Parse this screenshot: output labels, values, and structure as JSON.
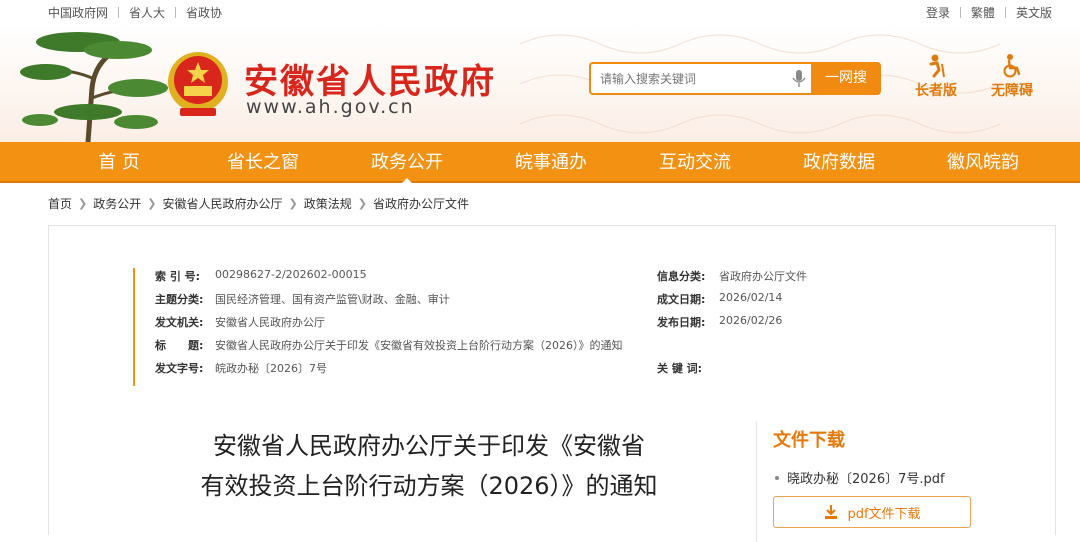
{
  "topbar": {
    "links_left": [
      "中国政府网",
      "省人大",
      "省政协"
    ],
    "links_right": [
      "登录",
      "繁體",
      "英文版"
    ]
  },
  "header": {
    "site_title": "安徽省人民政府",
    "site_url": "www.ah.gov.cn",
    "search_placeholder": "请输入搜索关键词",
    "search_button": "一网搜",
    "quick_links": [
      "长者版",
      "无障碍"
    ]
  },
  "nav": {
    "items": [
      "首 页",
      "省长之窗",
      "政务公开",
      "皖事通办",
      "互动交流",
      "政府数据",
      "徽风皖韵"
    ],
    "active_index": 2
  },
  "breadcrumb": [
    "首页",
    "政务公开",
    "安徽省人民政府办公厅",
    "政策法规",
    "省政府办公厅文件"
  ],
  "meta": {
    "index_label": "索 引 号:",
    "index_value": "00298627-2/202602-00015",
    "category_label": "信息分类:",
    "category_value": "省政府办公厅文件",
    "topic_label": "主题分类:",
    "topic_value": "国民经济管理、国有资产监管\\财政、金融、审计",
    "created_label": "成文日期:",
    "created_value": "2026/02/14",
    "issuer_label": "发文机关:",
    "issuer_value": "安徽省人民政府办公厅",
    "published_label": "发布日期:",
    "published_value": "2026/02/26",
    "title_label": "标　　题:",
    "title_value": "安徽省人民政府办公厅关于印发《安徽省有效投资上台阶行动方案（2026）》的通知",
    "docno_label": "发文字号:",
    "docno_value": "皖政办秘〔2026〕7号",
    "keywords_label": "关 键 词:",
    "keywords_value": ""
  },
  "document": {
    "title_line1": "安徽省人民政府办公厅关于印发《安徽省",
    "title_line2": "有效投资上台阶行动方案（2026）》的通知"
  },
  "download": {
    "heading": "文件下载",
    "file_name": "晓政办秘〔2026〕7号.pdf",
    "button_label": "pdf文件下载"
  },
  "colors": {
    "accent_orange": "#f39113",
    "title_red": "#d9261c"
  }
}
